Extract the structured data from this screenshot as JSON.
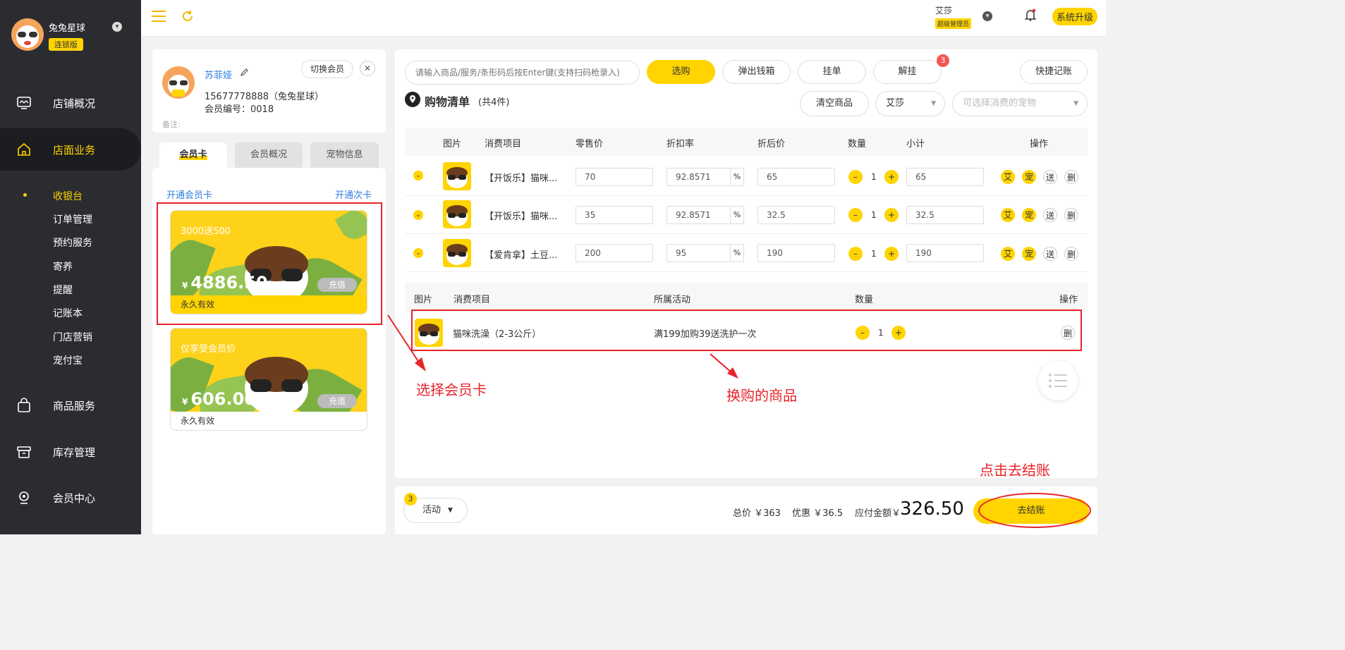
{
  "sidebar": {
    "store_name": "兔兔星球",
    "store_badge": "连锁版",
    "nav": [
      {
        "label": "店铺概况"
      },
      {
        "label": "店面业务"
      },
      {
        "label": "商品服务"
      },
      {
        "label": "库存管理"
      },
      {
        "label": "会员中心"
      }
    ],
    "sub": [
      "收银台",
      "订单管理",
      "预约服务",
      "寄养",
      "提醒",
      "记账本",
      "门店营销",
      "宠付宝"
    ]
  },
  "topbar": {
    "user_name": "艾莎",
    "user_role": "超级管理员",
    "upgrade": "系统升级"
  },
  "member": {
    "name": "苏菲娅",
    "switch_label": "切换会员",
    "phone": "15677778888（兔兔星球）",
    "number": "会员编号：0018",
    "note_label": "备注:"
  },
  "tabs": [
    "会员卡",
    "会员概况",
    "宠物信息"
  ],
  "card_links": {
    "open_card": "开通会员卡",
    "open_times": "开通次卡"
  },
  "cards": [
    {
      "title": "3000送500",
      "currency": "¥",
      "amount": "4886.50",
      "recharge": "充值",
      "validity": "永久有效"
    },
    {
      "title": "仅享受会员价",
      "currency": "¥",
      "amount": "606.00",
      "recharge": "充值",
      "validity": "永久有效"
    }
  ],
  "toolbar": {
    "search_placeholder": "请输入商品/服务/条形码后按Enter键(支持扫码枪录入)",
    "select": "选购",
    "cash_drawer": "弹出钱箱",
    "hang": "挂单",
    "unhang": "解挂",
    "unhang_count": "3",
    "quick_account": "快捷记账",
    "clear": "清空商品",
    "staff": "艾莎",
    "pet_placeholder": "可选择消费的宠物"
  },
  "list": {
    "title": "购物清单",
    "count": "(共4件)"
  },
  "table": {
    "headers": [
      "图片",
      "消费项目",
      "零售价",
      "折扣率",
      "折后价",
      "数量",
      "小计",
      "操作"
    ],
    "rows": [
      {
        "name": "【开饭乐】猫咪...",
        "price": "70",
        "rate": "92.8571",
        "after": "65",
        "qty": "1",
        "subtotal": "65"
      },
      {
        "name": "【开饭乐】猫咪...",
        "price": "35",
        "rate": "92.8571",
        "after": "32.5",
        "qty": "1",
        "subtotal": "32.5"
      },
      {
        "name": "【爱肯拿】土豆...",
        "price": "200",
        "rate": "95",
        "after": "190",
        "qty": "1",
        "subtotal": "190"
      }
    ],
    "percent": "%",
    "ops": [
      "艾",
      "宠",
      "送",
      "删"
    ]
  },
  "exchange": {
    "headers": [
      "图片",
      "消费项目",
      "所属活动",
      "数量",
      "操作"
    ],
    "rows": [
      {
        "name": "猫咪洗澡（2-3公斤）",
        "activity": "满199加购39送洗护一次",
        "qty": "1",
        "op": "删"
      }
    ]
  },
  "annotations": {
    "select_card": "选择会员卡",
    "exchange_goods": "换购的商品",
    "click_checkout": "点击去结账"
  },
  "bottom": {
    "activity_count": "3",
    "activity": "活动",
    "total": "总价 ￥363",
    "discount": "优惠 ￥36.5",
    "payable_label": "应付金额￥",
    "payable": "326.50",
    "checkout": "去结账"
  }
}
